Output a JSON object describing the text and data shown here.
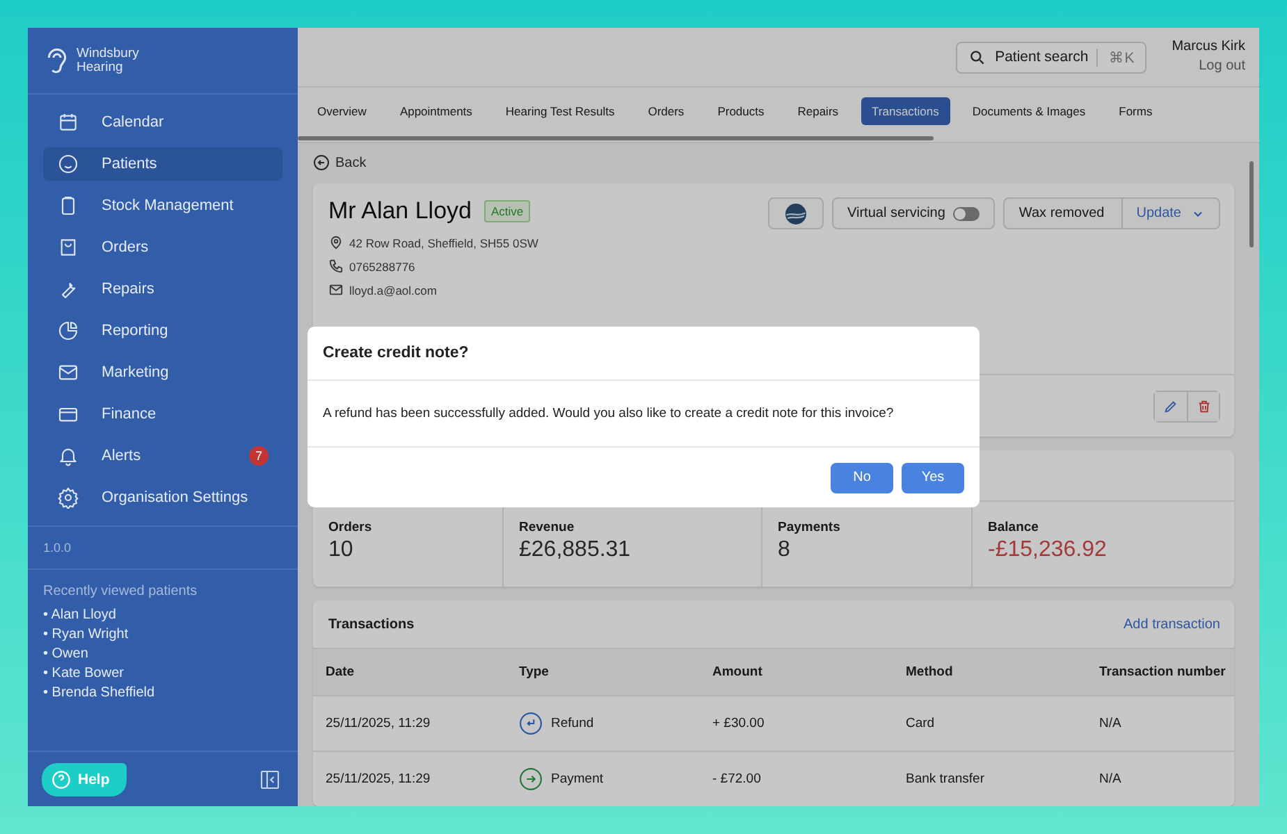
{
  "brand": {
    "name_line1": "Windsbury",
    "name_line2": "Hearing"
  },
  "nav": [
    {
      "label": "Calendar",
      "selected": false
    },
    {
      "label": "Patients",
      "selected": true
    },
    {
      "label": "Stock Management",
      "selected": false
    },
    {
      "label": "Orders",
      "selected": false
    },
    {
      "label": "Repairs",
      "selected": false
    },
    {
      "label": "Reporting",
      "selected": false
    },
    {
      "label": "Marketing",
      "selected": false
    },
    {
      "label": "Finance",
      "selected": false
    },
    {
      "label": "Alerts",
      "selected": false,
      "badge": "7"
    },
    {
      "label": "Organisation Settings",
      "selected": false
    }
  ],
  "version": "1.0.0",
  "recent": {
    "title": "Recently viewed patients",
    "items": [
      "• Alan Lloyd",
      "• Ryan Wright",
      "• Owen",
      "• Kate Bower",
      "• Brenda Sheffield"
    ]
  },
  "help": "Help",
  "header": {
    "search": "Patient search",
    "shortcut": "⌘K",
    "user": "Marcus Kirk",
    "logout": "Log out"
  },
  "tabs": [
    {
      "label": "Overview",
      "selected": false
    },
    {
      "label": "Appointments",
      "selected": false
    },
    {
      "label": "Hearing Test Results",
      "selected": false
    },
    {
      "label": "Orders",
      "selected": false
    },
    {
      "label": "Products",
      "selected": false
    },
    {
      "label": "Repairs",
      "selected": false
    },
    {
      "label": "Transactions",
      "selected": true
    },
    {
      "label": "Documents & Images",
      "selected": false
    },
    {
      "label": "Forms",
      "selected": false
    }
  ],
  "back": "Back",
  "patient": {
    "name": "Mr Alan Lloyd",
    "status": "Active",
    "address": "42 Row Road, Sheffield, SH55 0SW",
    "phone": "0765288776",
    "email": "lloyd.a@aol.com",
    "virtual_servicing": {
      "label": "Virtual servicing",
      "on": false
    },
    "wax": "Wax removed",
    "update": "Update"
  },
  "stats": [
    {
      "label": "Orders",
      "value": "10",
      "negative": false
    },
    {
      "label": "Revenue",
      "value": "£26,885.31",
      "negative": false
    },
    {
      "label": "Payments",
      "value": "8",
      "negative": false
    },
    {
      "label": "Balance",
      "value": "-£15,236.92",
      "negative": true
    }
  ],
  "transactions": {
    "title": "Transactions",
    "add": "Add transaction",
    "columns": [
      "Date",
      "Type",
      "Amount",
      "Method",
      "Transaction number"
    ],
    "rows": [
      {
        "date": "25/11/2025, 11:29",
        "type": "Refund",
        "kind": "refund",
        "amount": "+ £30.00",
        "method": "Card",
        "number": "N/A"
      },
      {
        "date": "25/11/2025, 11:29",
        "type": "Payment",
        "kind": "payment",
        "amount": "- £72.00",
        "method": "Bank transfer",
        "number": "N/A"
      }
    ]
  },
  "dialog": {
    "title": "Create credit note?",
    "message": "A refund has been successfully added. Would you also like to create a credit note for this invoice?",
    "buttons": [
      "No",
      "Yes"
    ]
  }
}
